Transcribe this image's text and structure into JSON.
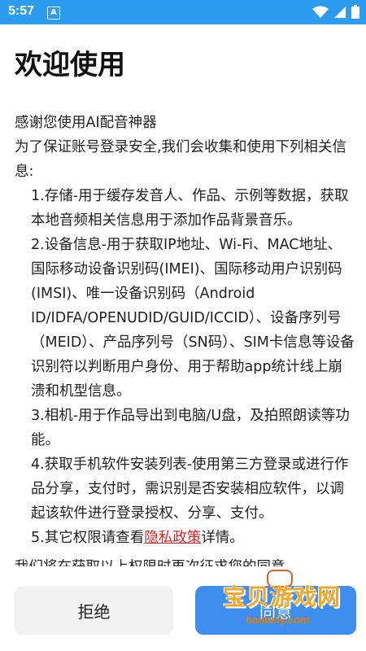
{
  "statusbar": {
    "time": "5:57",
    "app_icon_letter": "A"
  },
  "page": {
    "title": "欢迎使用"
  },
  "content": {
    "intro1": "感谢您使用AI配音神器",
    "intro2": "为了保证账号登录安全,我们会收集和使用下列相关信息:",
    "item1": "1.存储-用于缓存发音人、作品、示例等数据，获取本地音频相关信息用于添加作品背景音乐。",
    "item2": "2.设备信息-用于获取IP地址、Wi-Fi、MAC地址、国际移动设备识别码(IMEI)、国际移动用户识别码(IMSI)、唯一设备识别码（Android ID/IDFA/OPENUDID/GUID/ICCID）、设备序列号（MEID）、产品序列号（SN码）、SIM卡信息等设备识别符以判断用户身份、用于帮助app统计线上崩溃和机型信息。",
    "item3": "3.相机-用于作品导出到电脑/U盘，及拍照朗读等功能。",
    "item4": "4.获取手机软件安装列表-使用第三方登录或进行作品分享，支付时，需识别是否安装相应软件，以调起该软件进行登录授权、分享、支付。",
    "item5_prefix": "5.其它权限请查看",
    "item5_link": "隐私政策",
    "item5_suffix": "详情。",
    "trailing": "我们将在获取以上权限时再次征求您的同意"
  },
  "buttons": {
    "reject": "拒绝",
    "agree": "同意"
  },
  "watermark": {
    "text": "宝贝游戏网",
    "url": "baobeiy.com"
  },
  "colors": {
    "statusbar": "#2b9cf0",
    "link": "#e02424",
    "agree_button": "#3e8ef0"
  }
}
